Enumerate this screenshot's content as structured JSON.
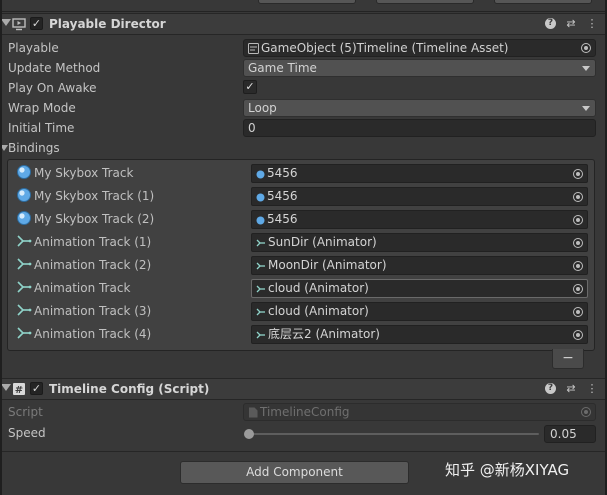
{
  "playable_director": {
    "title": "Playable Director",
    "playable_label": "Playable",
    "playable_value": "GameObject (5)Timeline (Timeline Asset)",
    "update_method_label": "Update Method",
    "update_method_value": "Game Time",
    "play_on_awake_label": "Play On Awake",
    "play_on_awake_checked": true,
    "wrap_mode_label": "Wrap Mode",
    "wrap_mode_value": "Loop",
    "initial_time_label": "Initial Time",
    "initial_time_value": "0",
    "bindings_label": "Bindings",
    "bindings": [
      {
        "track": "My Skybox Track",
        "value": "5456",
        "icon": "skybox-track-icon"
      },
      {
        "track": "My Skybox Track (1)",
        "value": "5456",
        "icon": "skybox-track-icon"
      },
      {
        "track": "My Skybox Track (2)",
        "value": "5456",
        "icon": "skybox-track-icon"
      },
      {
        "track": "Animation Track (1)",
        "value": "SunDir (Animator)",
        "icon": "animation-track-icon"
      },
      {
        "track": "Animation Track (2)",
        "value": "MoonDir (Animator)",
        "icon": "animation-track-icon"
      },
      {
        "track": "Animation Track",
        "value": "cloud (Animator)",
        "icon": "animation-track-icon"
      },
      {
        "track": "Animation Track (3)",
        "value": "cloud (Animator)",
        "icon": "animation-track-icon"
      },
      {
        "track": "Animation Track (4)",
        "value": "底层云2 (Animator)",
        "icon": "animation-track-icon"
      }
    ],
    "remove_label": "−"
  },
  "timeline_config": {
    "title": "Timeline Config (Script)",
    "script_label": "Script",
    "script_value": "TimelineConfig",
    "speed_label": "Speed",
    "speed_value": "0.05",
    "speed_fraction": 0.0
  },
  "add_component_label": "Add Component",
  "watermark": "知乎 @新杨XIYAG",
  "colors": {
    "panel": "#383838",
    "field": "#2a2a2a",
    "skybox_icon": "#5fa9e6",
    "animation_icon": "#8fd3c9"
  }
}
